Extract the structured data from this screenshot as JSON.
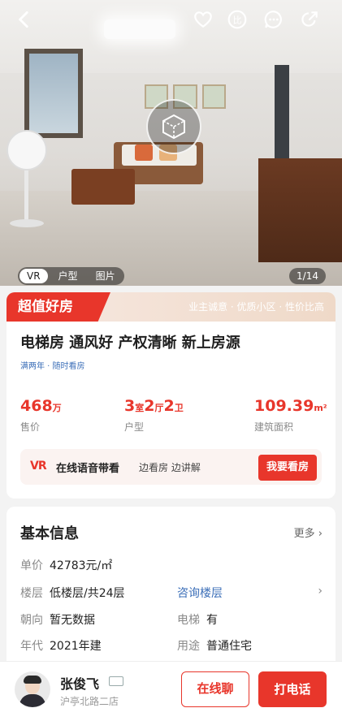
{
  "hero": {
    "media_tabs": [
      "VR",
      "户型",
      "图片"
    ],
    "active_tab": "VR",
    "counter": "1/14"
  },
  "topbar": {
    "icons": [
      "back-icon",
      "favorite-icon",
      "compare-icon",
      "message-icon",
      "share-icon"
    ],
    "compare_label": "比"
  },
  "promo": {
    "tag": "超值好房",
    "text": "业主诚意 · 优质小区 · 性价比高"
  },
  "listing": {
    "title": "电梯房 通风好 产权清晰 新上房源",
    "tags": "满两年 · 随时看房",
    "price": {
      "value": "468",
      "unit": "万",
      "label": "售价"
    },
    "layout": {
      "rooms": "3",
      "rooms_unit": "室",
      "halls": "2",
      "halls_unit": "厅",
      "baths": "2",
      "baths_unit": "卫",
      "label": "户型"
    },
    "area": {
      "value": "109.39",
      "unit": "m²",
      "label": "建筑面积"
    }
  },
  "vr_guide": {
    "logo": "VR",
    "main": "在线语音带看",
    "sub": "边看房 边讲解",
    "button": "我要看房"
  },
  "basic_info": {
    "title": "基本信息",
    "more": "更多",
    "unit_price": {
      "k": "单价",
      "v": "42783元/㎡"
    },
    "floor": {
      "k": "楼层",
      "v": "低楼层/共24层",
      "link": "咨询楼层"
    },
    "orientation": {
      "k": "朝向",
      "v": "暂无数据"
    },
    "elevator": {
      "k": "电梯",
      "v": "有"
    },
    "year": {
      "k": "年代",
      "v": "2021年建"
    },
    "usage": {
      "k": "用途",
      "v": "普通住宅"
    }
  },
  "agent": {
    "name": "张俊飞",
    "store": "沪亭北路二店",
    "chat_button": "在线聊",
    "call_button": "打电话"
  },
  "colors": {
    "accent": "#e8362b",
    "link": "#3c6fb8"
  }
}
